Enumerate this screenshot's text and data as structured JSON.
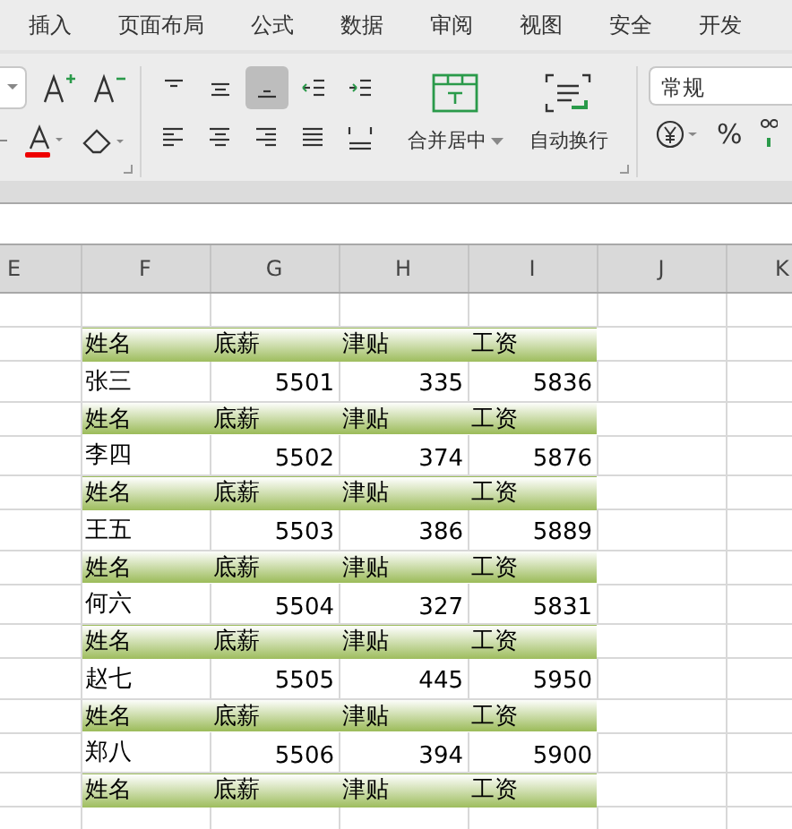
{
  "menu_tabs": [
    {
      "label": "插入",
      "selected": false
    },
    {
      "label": "页面布局",
      "selected": false
    },
    {
      "label": "公式",
      "selected": false
    },
    {
      "label": "数据",
      "selected": false
    },
    {
      "label": "审阅",
      "selected": false
    },
    {
      "label": "视图",
      "selected": false
    },
    {
      "label": "安全",
      "selected": false
    },
    {
      "label": "开发"
    }
  ],
  "ribbon": {
    "align_buttons": [
      {
        "selected": false
      },
      {
        "selected": false
      },
      {
        "selected": true
      },
      {
        "selected": false
      },
      {
        "selected": false
      },
      {
        "selected": false
      },
      {
        "selected": false
      },
      {
        "selected": false
      },
      {
        "selected": false
      },
      {
        "selected": false
      }
    ],
    "merge_label": "合并居中",
    "wrap_label": "自动换行",
    "number_format": "常规",
    "percent": "%"
  },
  "sheet": {
    "columns": [
      "E",
      "F",
      "G",
      "H",
      "I",
      "J",
      "K"
    ],
    "rows": [
      {
        "kind": "header",
        "cells": [
          "",
          "姓名",
          "底薪",
          "津贴",
          "工资"
        ]
      },
      {
        "kind": "data",
        "cells": [
          "",
          "张三",
          "5501",
          "335",
          "5836"
        ]
      },
      {
        "kind": "header",
        "cells": [
          "",
          "姓名",
          "底薪",
          "津贴",
          "工资"
        ]
      },
      {
        "kind": "data",
        "cells": [
          "",
          "李四",
          "5502",
          "374",
          "5876"
        ]
      },
      {
        "kind": "header",
        "cells": [
          "",
          "姓名",
          "底薪",
          "津贴",
          "工资"
        ]
      },
      {
        "kind": "data",
        "cells": [
          "",
          "王五",
          "5503",
          "386",
          "5889"
        ]
      },
      {
        "kind": "header",
        "cells": [
          "",
          "姓名",
          "底薪",
          "津贴",
          "工资"
        ]
      },
      {
        "kind": "data",
        "cells": [
          "",
          "何六",
          "5504",
          "327",
          "5831"
        ]
      },
      {
        "kind": "header",
        "cells": [
          "",
          "姓名",
          "底薪",
          "津贴",
          "工资"
        ]
      },
      {
        "kind": "data",
        "cells": [
          "",
          "赵七",
          "5505",
          "445",
          "5950"
        ]
      },
      {
        "kind": "header",
        "cells": [
          "",
          "姓名",
          "底薪",
          "津贴",
          "工资"
        ]
      },
      {
        "kind": "data",
        "cells": [
          "",
          "郑八",
          "5506",
          "394",
          "5900"
        ]
      },
      {
        "kind": "header",
        "cells": [
          "",
          "姓名",
          "底薪",
          "津贴",
          "工资"
        ]
      }
    ]
  }
}
